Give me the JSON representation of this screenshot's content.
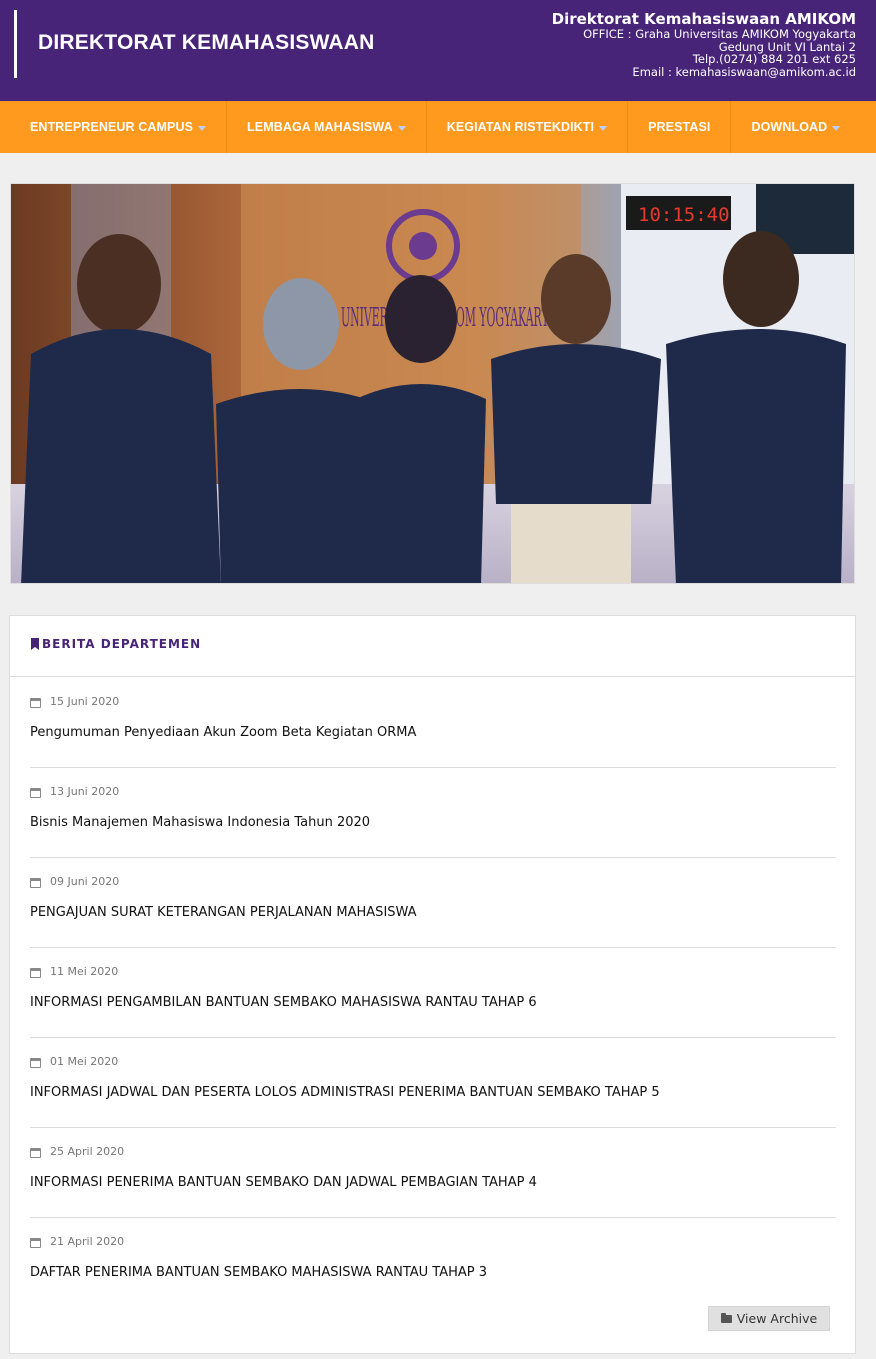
{
  "header": {
    "site_title": "DIREKTORAT KEMAHASISWAAN",
    "org_name": "Direktorat Kemahasiswaan AMIKOM",
    "office": "OFFICE : Graha Universitas AMIKOM Yogyakarta",
    "building": "Gedung Unit VI Lantai 2",
    "phone": "Telp.(0274) 884 201 ext 625",
    "email": "Email : kemahasiswaan@amikom.ac.id"
  },
  "nav": {
    "items": [
      {
        "label": "ENTREPRENEUR CAMPUS",
        "has_dropdown": true
      },
      {
        "label": "LEMBAGA MAHASISWA",
        "has_dropdown": true
      },
      {
        "label": "KEGIATAN RISTEKDIKTI",
        "has_dropdown": true
      },
      {
        "label": "PRESTASI",
        "has_dropdown": false
      },
      {
        "label": "DOWNLOAD",
        "has_dropdown": true
      }
    ]
  },
  "banner": {
    "sign_text": "UNIVERSITAS AMIKOM YOGYAKARTA",
    "clock_text": "10:15:40"
  },
  "news": {
    "section_title": "BERITA DEPARTEMEN",
    "items": [
      {
        "date": "15 Juni 2020",
        "title": "Pengumuman Penyediaan Akun Zoom Beta Kegiatan ORMA"
      },
      {
        "date": "13 Juni 2020",
        "title": "Bisnis Manajemen Mahasiswa Indonesia Tahun 2020"
      },
      {
        "date": "09 Juni 2020",
        "title": "PENGAJUAN SURAT KETERANGAN PERJALANAN MAHASISWA"
      },
      {
        "date": "11 Mei 2020",
        "title": "INFORMASI PENGAMBILAN BANTUAN SEMBAKO MAHASISWA RANTAU TAHAP 6"
      },
      {
        "date": "01 Mei 2020",
        "title": "INFORMASI JADWAL DAN PESERTA LOLOS ADMINISTRASI PENERIMA BANTUAN SEMBAKO TAHAP 5"
      },
      {
        "date": "25 April 2020",
        "title": "INFORMASI PENERIMA BANTUAN SEMBAKO DAN JADWAL PEMBAGIAN TAHAP 4"
      },
      {
        "date": "21 April 2020",
        "title": "DAFTAR PENERIMA BANTUAN SEMBAKO MAHASISWA RANTAU TAHAP 3"
      }
    ],
    "archive_label": "View Archive"
  },
  "colors": {
    "header_bg": "#472478",
    "nav_bg": "#ff9a1f",
    "accent": "#472478"
  }
}
